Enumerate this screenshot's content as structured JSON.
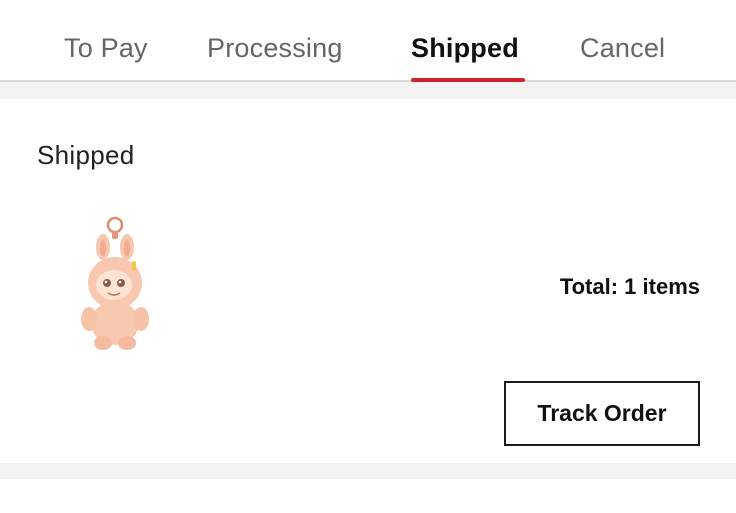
{
  "tabs": [
    {
      "label": "To Pay",
      "active": false
    },
    {
      "label": "Processing",
      "active": false
    },
    {
      "label": "Shipped",
      "active": true
    },
    {
      "label": "Cancel",
      "active": false
    }
  ],
  "colors": {
    "accent": "#d4202f",
    "separator": "#f3f3f3"
  },
  "order": {
    "status": "Shipped",
    "product_image_icon": "plush-keychain-image",
    "total_text": "Total: 1 items",
    "track_button_label": "Track Order"
  }
}
